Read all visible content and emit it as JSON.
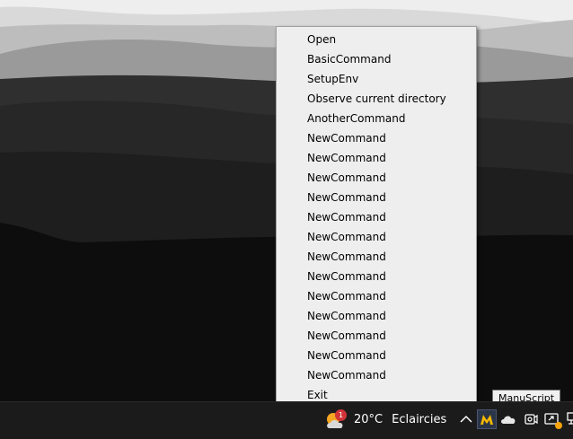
{
  "menu": {
    "items": [
      {
        "label": "Open"
      },
      {
        "label": "BasicCommand"
      },
      {
        "label": "SetupEnv"
      },
      {
        "label": "Observe current directory"
      },
      {
        "label": "AnotherCommand"
      },
      {
        "label": "NewCommand"
      },
      {
        "label": "NewCommand"
      },
      {
        "label": "NewCommand"
      },
      {
        "label": "NewCommand"
      },
      {
        "label": "NewCommand"
      },
      {
        "label": "NewCommand"
      },
      {
        "label": "NewCommand"
      },
      {
        "label": "NewCommand"
      },
      {
        "label": "NewCommand"
      },
      {
        "label": "NewCommand"
      },
      {
        "label": "NewCommand"
      },
      {
        "label": "NewCommand"
      },
      {
        "label": "NewCommand"
      },
      {
        "label": "Exit"
      }
    ]
  },
  "tooltip": {
    "text": "ManuScript"
  },
  "taskbar": {
    "weather": {
      "badge": "1",
      "temperature": "20°C",
      "condition": "Eclaircies"
    },
    "tray_icons": [
      "chevron-up-icon",
      "manuscript-icon",
      "onedrive-cloud-icon",
      "camera-icon",
      "screen-share-icon",
      "network-icon"
    ]
  },
  "colors": {
    "menu_background": "#eeeeee",
    "taskbar_background": "#1b1b1b",
    "manuscript_accent": "#f5b800"
  }
}
